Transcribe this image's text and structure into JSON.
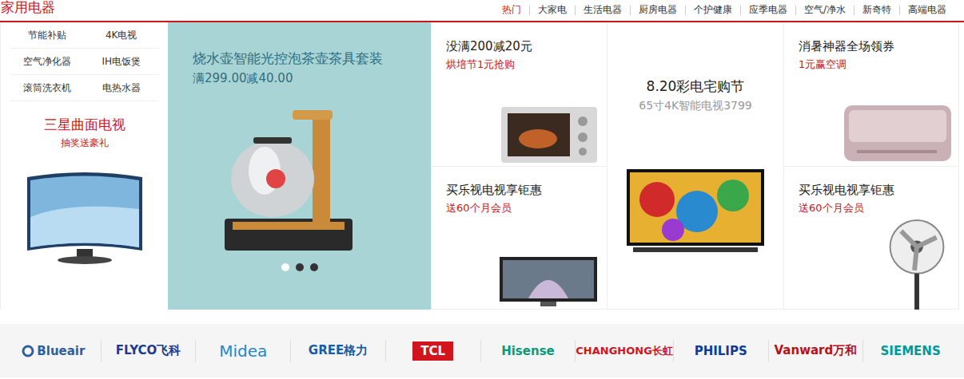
{
  "header": {
    "title": "家用电器",
    "nav": [
      {
        "label": "热门",
        "selected": true
      },
      {
        "label": "大家电",
        "selected": false
      },
      {
        "label": "生活电器",
        "selected": false
      },
      {
        "label": "厨房电器",
        "selected": false
      },
      {
        "label": "个护健康",
        "selected": false
      },
      {
        "label": "应季电器",
        "selected": false
      },
      {
        "label": "空气/净水",
        "selected": false
      },
      {
        "label": "新奇特",
        "selected": false
      },
      {
        "label": "高端电器",
        "selected": false
      }
    ]
  },
  "sidebar": {
    "links": [
      "节能补贴",
      "4K电视",
      "空气净化器",
      "IH电饭煲",
      "滚筒洗衣机",
      "电热水器"
    ],
    "promo": {
      "title": "三星曲面电视",
      "subtitle": "抽奖送豪礼"
    }
  },
  "banner": {
    "title": "烧水壶智能光控泡茶壶茶具套装",
    "price": "满299.00减40.00",
    "dots": [
      {
        "selected": true
      },
      {
        "selected": false
      },
      {
        "selected": false
      }
    ]
  },
  "cells": [
    {
      "title": "没满200减20元",
      "subtitle": "烘培节1元抢购",
      "kind": "oven"
    },
    {
      "title": "买乐视电视享钜惠",
      "subtitle": "送60个月会员",
      "kind": "tv"
    },
    {
      "title": "消暑神器全场领券",
      "subtitle": "1元赢空调",
      "kind": "aircon"
    },
    {
      "title": "买乐视电视享钜惠",
      "subtitle": "送60个月会员",
      "kind": "fan"
    }
  ],
  "feature": {
    "title": "8.20彩电宅购节",
    "subtitle": "65寸4K智能电视3799"
  },
  "brands": [
    {
      "name": "Blueair",
      "color": "#2f5f9e",
      "kind": "icon"
    },
    {
      "name": "FLYCO飞科",
      "color": "#1b3d8c",
      "kind": "plain"
    },
    {
      "name": "Midea",
      "color": "#1e88c8",
      "kind": "large"
    },
    {
      "name": "GREE格力",
      "color": "#1a5aa6",
      "kind": "plain"
    },
    {
      "name": "TCL",
      "color": "#ffffff",
      "kind": "boxed"
    },
    {
      "name": "Hisense",
      "color": "#0a9a7a",
      "kind": "plain"
    },
    {
      "name": "CHANGHONG长虹",
      "color": "#d2141e",
      "kind": "small"
    },
    {
      "name": "PHILIPS",
      "color": "#0b3e9c",
      "kind": "plain"
    },
    {
      "name": "Vanward万和",
      "color": "#b5121b",
      "kind": "plain"
    },
    {
      "name": "SIEMENS",
      "color": "#009999",
      "kind": "plain"
    }
  ]
}
